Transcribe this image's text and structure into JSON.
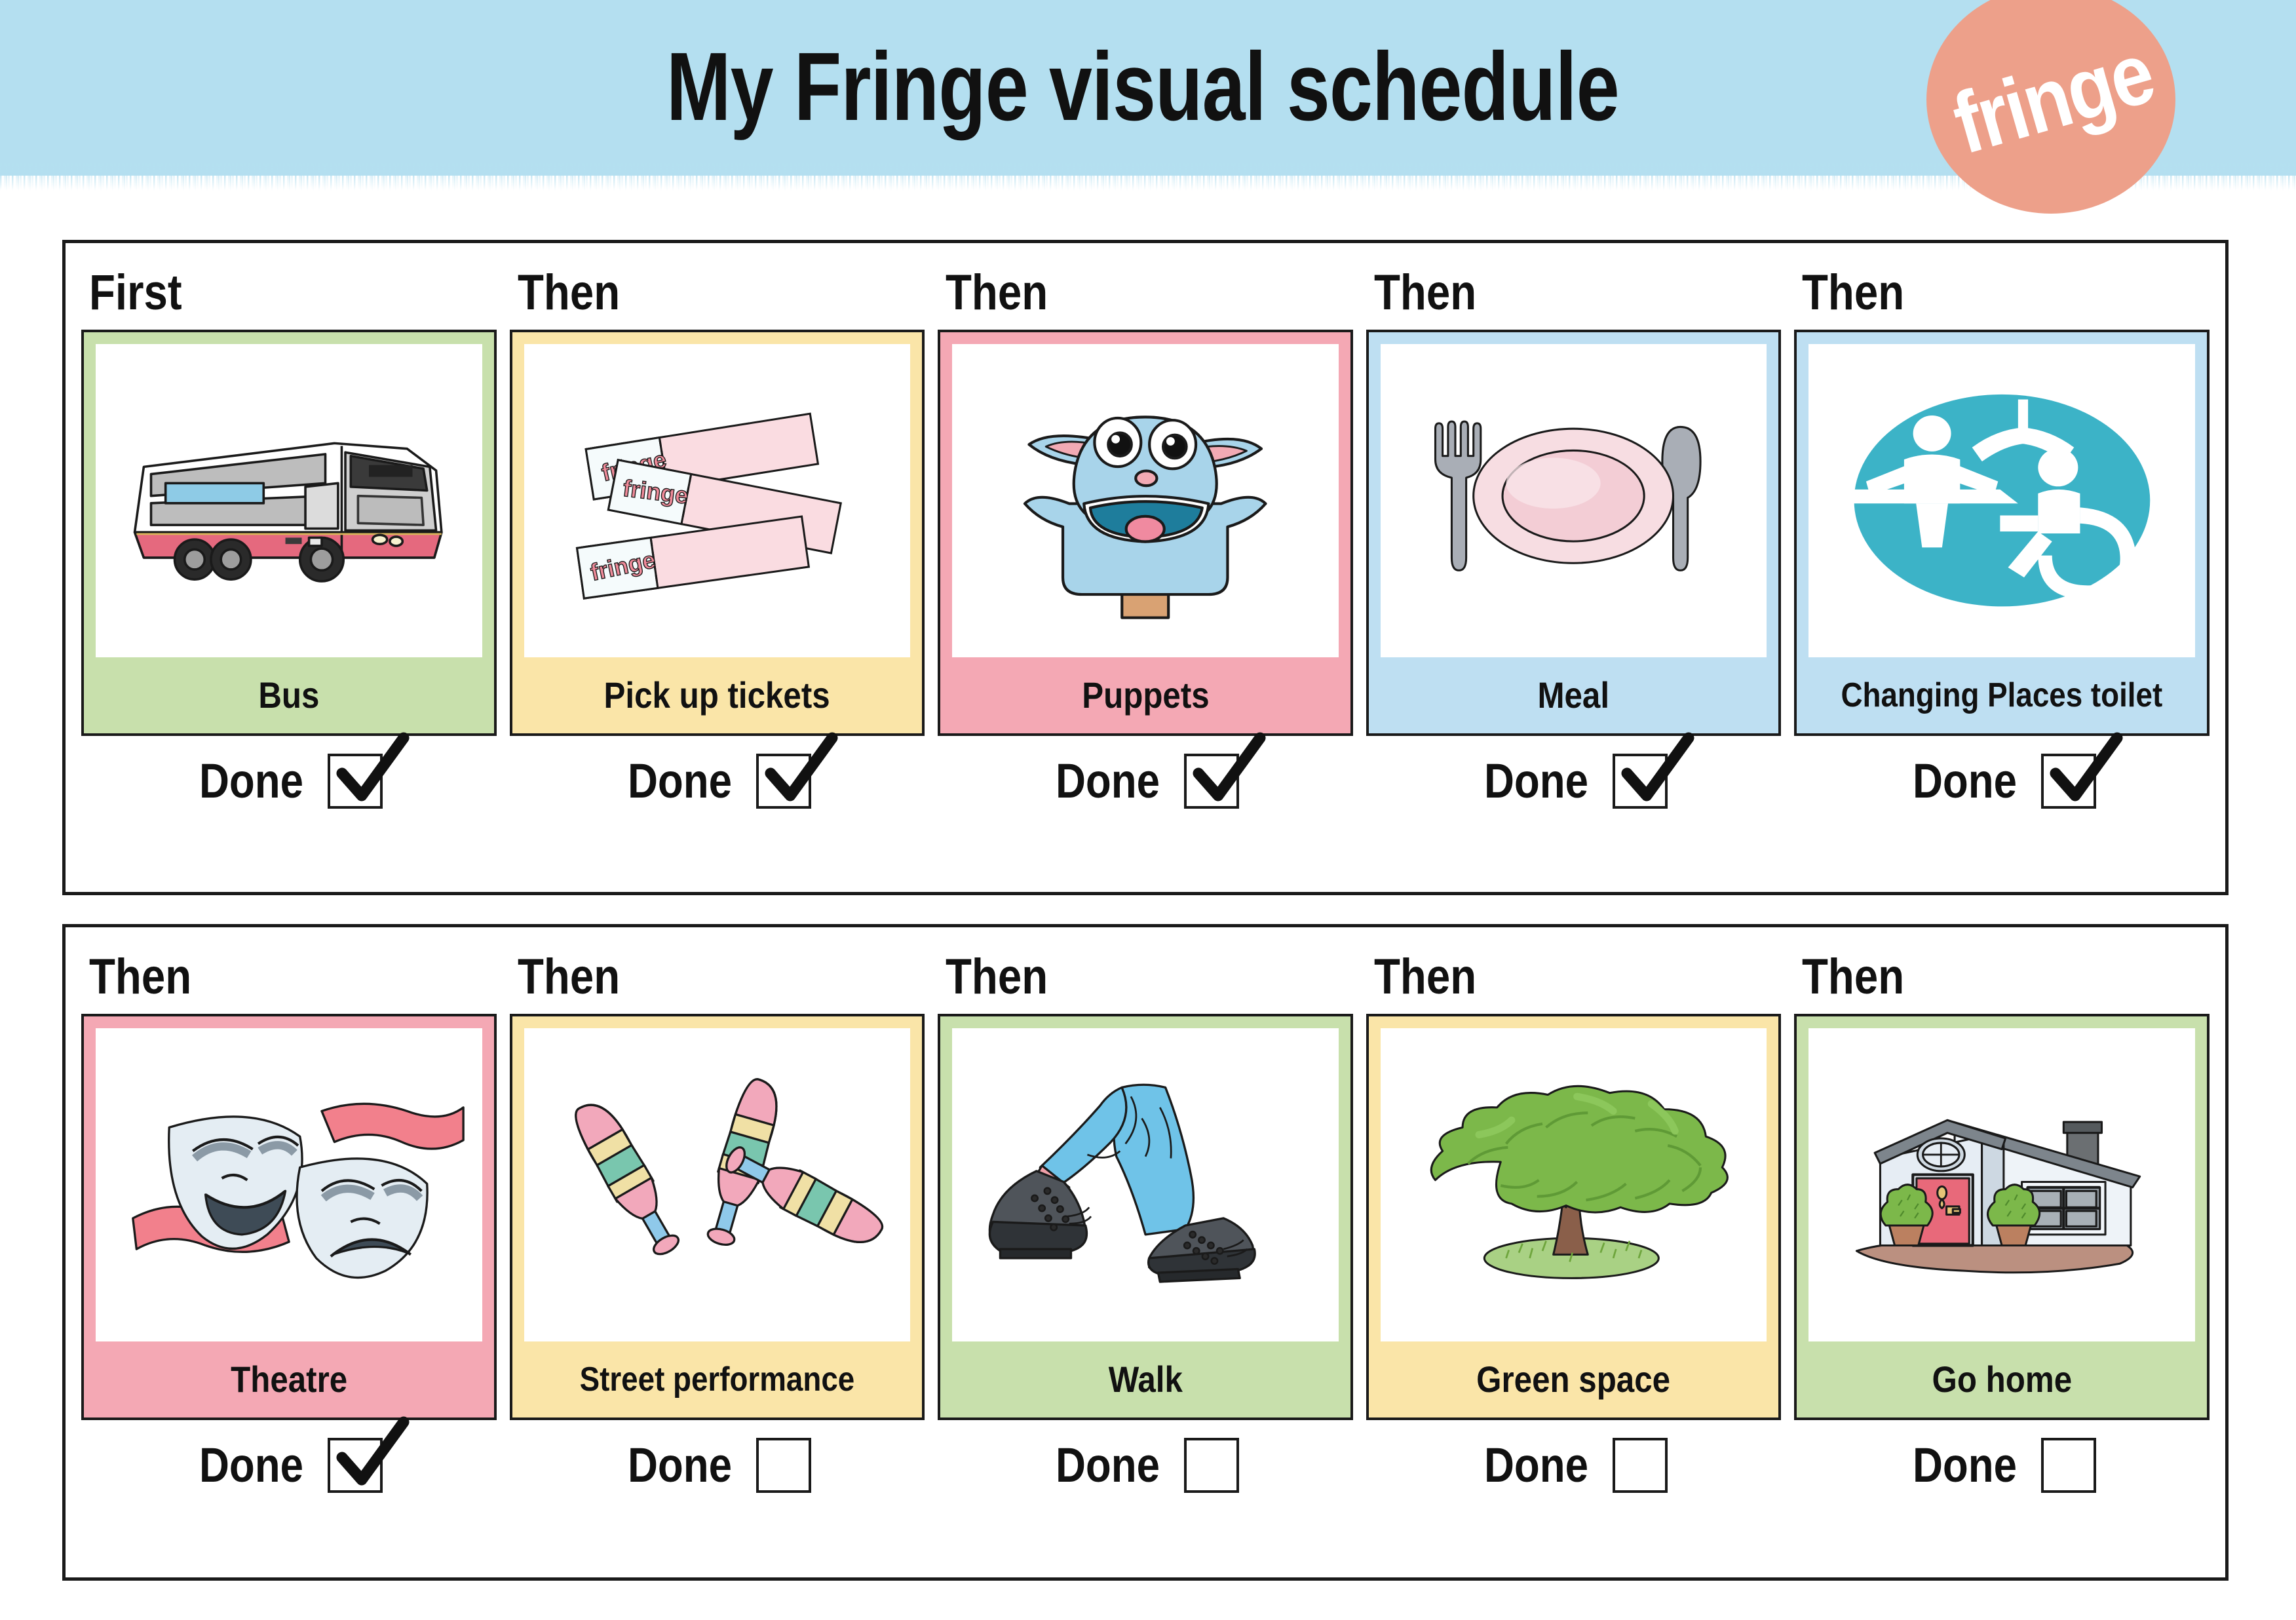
{
  "header": {
    "title": "My Fringe visual schedule",
    "logo_text": "fringe",
    "band_color": "#b4dff0",
    "logo_color": "#eda08a"
  },
  "done_label": "Done",
  "colors": {
    "green": "#c8e0ac",
    "yellow": "#fae5a8",
    "pink": "#f4a8b4",
    "blue": "#bedff2",
    "teal_sign": "#3cb3c7",
    "bus_red": "#e5697e",
    "border": "#1a1a1a"
  },
  "rows": [
    {
      "panel": "panel-1",
      "slots": [
        {
          "step": "First",
          "caption": "Bus",
          "icon": "bus-icon",
          "band": "green",
          "done": true
        },
        {
          "step": "Then",
          "caption": "Pick up tickets",
          "icon": "tickets-icon",
          "band": "yellow",
          "done": true
        },
        {
          "step": "Then",
          "caption": "Puppets",
          "icon": "hand-puppet-icon",
          "band": "pink",
          "done": true
        },
        {
          "step": "Then",
          "caption": "Meal",
          "icon": "plate-cutlery-icon",
          "band": "blue",
          "done": true
        },
        {
          "step": "Then",
          "caption": "Changing Places toilet",
          "icon": "changing-places-icon",
          "band": "blue",
          "done": true
        }
      ]
    },
    {
      "panel": "panel-2",
      "slots": [
        {
          "step": "Then",
          "caption": "Theatre",
          "icon": "theatre-masks-icon",
          "band": "pink",
          "done": true
        },
        {
          "step": "Then",
          "caption": "Street performance",
          "icon": "juggling-clubs-icon",
          "band": "yellow",
          "done": false
        },
        {
          "step": "Then",
          "caption": "Walk",
          "icon": "walking-boots-icon",
          "band": "green",
          "done": false
        },
        {
          "step": "Then",
          "caption": "Green space",
          "icon": "tree-icon",
          "band": "yellow",
          "done": false
        },
        {
          "step": "Then",
          "caption": "Go home",
          "icon": "house-icon",
          "band": "green",
          "done": false
        }
      ]
    }
  ],
  "ticket_brand": "fringe"
}
